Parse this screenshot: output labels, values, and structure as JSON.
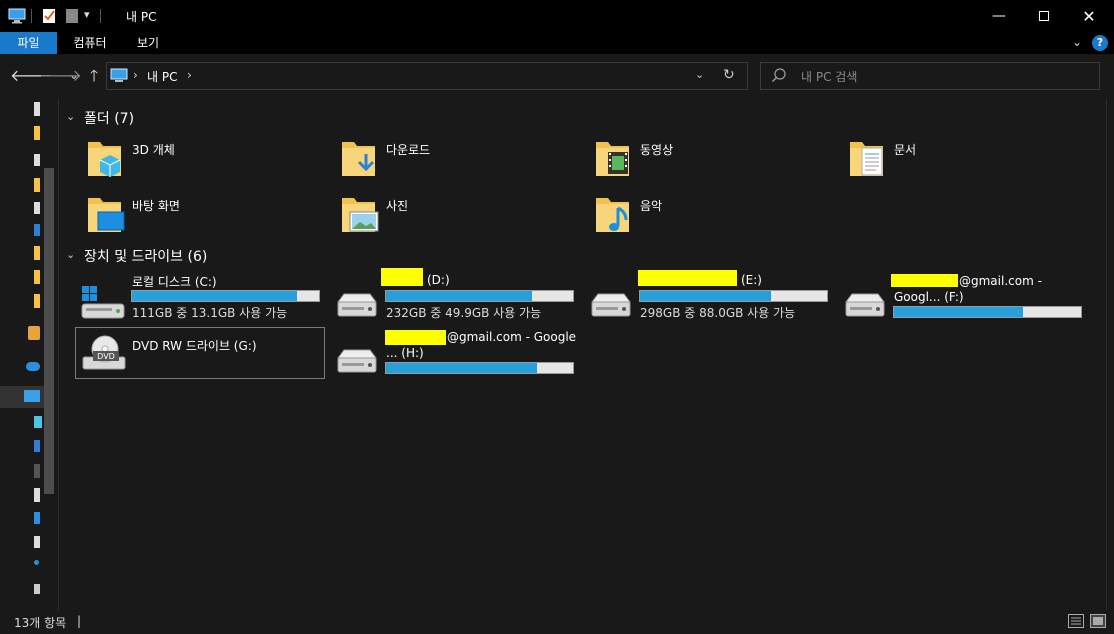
{
  "window": {
    "title": "내 PC"
  },
  "ribbon": {
    "tabs": [
      "파일",
      "컴퓨터",
      "보기"
    ]
  },
  "address": {
    "location": "내 PC"
  },
  "search": {
    "placeholder": "내 PC 검색"
  },
  "folders": {
    "header": "폴더 (7)",
    "items": [
      {
        "label": "3D 개체",
        "icon": "3d-objects-folder-icon"
      },
      {
        "label": "다운로드",
        "icon": "downloads-folder-icon"
      },
      {
        "label": "동영상",
        "icon": "videos-folder-icon"
      },
      {
        "label": "문서",
        "icon": "documents-folder-icon"
      },
      {
        "label": "바탕 화면",
        "icon": "desktop-folder-icon"
      },
      {
        "label": "사진",
        "icon": "pictures-folder-icon"
      },
      {
        "label": "음악",
        "icon": "music-folder-icon"
      }
    ]
  },
  "drives": {
    "header": "장치 및 드라이브 (6)",
    "items": [
      {
        "name": "로컬 디스크 (C:)",
        "free_text": "111GB 중 13.1GB 사용 가능",
        "used_fraction": 0.88,
        "icon": "windows-drive-icon"
      },
      {
        "name_suffix": "(D:)",
        "free_text": "232GB 중 49.9GB 사용 가능",
        "used_fraction": 0.78,
        "icon": "drive-icon"
      },
      {
        "name_suffix": "(E:)",
        "free_text": "298GB 중 88.0GB 사용 가능",
        "used_fraction": 0.7,
        "icon": "drive-icon"
      },
      {
        "name_line1": "@gmail.com -",
        "name_line2": "Googl... (F:)",
        "used_fraction": 0.69,
        "icon": "drive-icon"
      },
      {
        "name": "DVD RW 드라이브 (G:)",
        "icon": "dvd-drive-icon"
      },
      {
        "name_line1": "@gmail.com - Google",
        "name_line2": "... (H:)",
        "used_fraction": 0.81,
        "icon": "drive-icon"
      }
    ]
  },
  "status": {
    "item_count": "13개 항목",
    "separator": "|"
  },
  "colors": {
    "accent": "#1979ca",
    "bar_fill": "#26a0da",
    "redaction": "#ffff00",
    "background": "#191919"
  }
}
